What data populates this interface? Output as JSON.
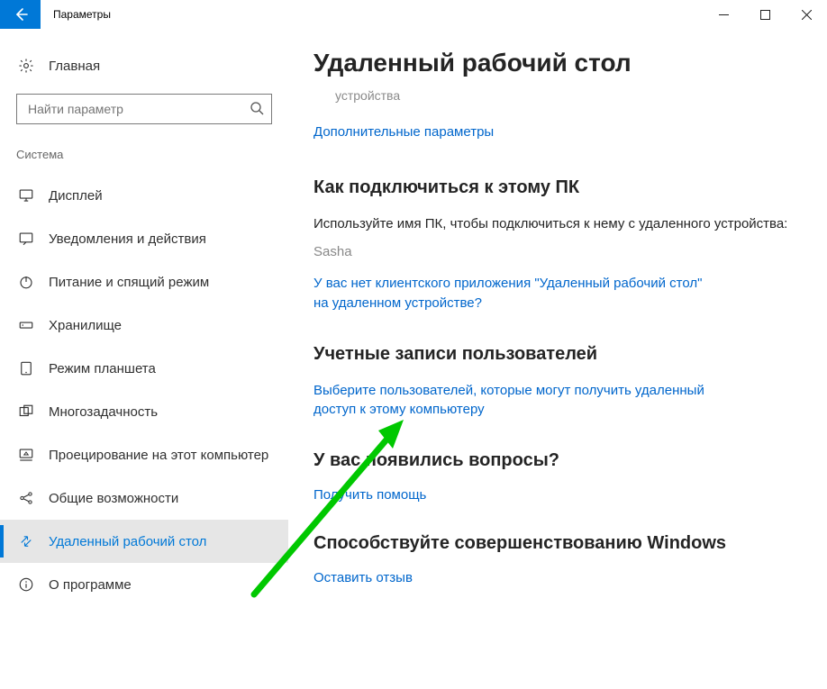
{
  "window": {
    "title": "Параметры"
  },
  "sidebar": {
    "home_label": "Главная",
    "search_placeholder": "Найти параметр",
    "group_label": "Система",
    "items": [
      {
        "key": "display",
        "label": "Дисплей"
      },
      {
        "key": "notifications",
        "label": "Уведомления и действия"
      },
      {
        "key": "power",
        "label": "Питание и спящий режим"
      },
      {
        "key": "storage",
        "label": "Хранилище"
      },
      {
        "key": "tablet",
        "label": "Режим планшета"
      },
      {
        "key": "multitask",
        "label": "Многозадачность"
      },
      {
        "key": "projecting",
        "label": "Проецирование на этот компьютер"
      },
      {
        "key": "shared",
        "label": "Общие возможности"
      },
      {
        "key": "remote",
        "label": "Удаленный рабочий стол"
      },
      {
        "key": "about",
        "label": "О программе"
      }
    ]
  },
  "content": {
    "title": "Удаленный рабочий стол",
    "devices_label": "устройства",
    "advanced_link": "Дополнительные параметры",
    "connect": {
      "heading": "Как подключиться к этому ПК",
      "text": "Используйте имя ПК, чтобы подключиться к нему с удаленного устройства:",
      "pc_name": "Sasha",
      "no_client_link": "У вас нет клиентского приложения \"Удаленный рабочий стол\" на удаленном устройстве?"
    },
    "users": {
      "heading": "Учетные записи пользователей",
      "select_users_link": "Выберите пользователей, которые могут получить удаленный доступ к этому компьютеру"
    },
    "help": {
      "heading": "У вас появились вопросы?",
      "get_help_link": "Получить помощь"
    },
    "feedback": {
      "heading": "Способствуйте совершенствованию Windows",
      "feedback_link": "Оставить отзыв"
    }
  }
}
